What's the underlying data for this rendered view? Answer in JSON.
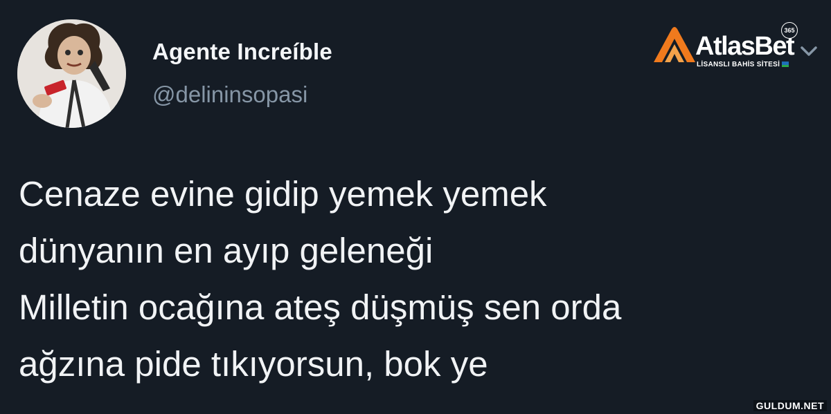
{
  "tweet": {
    "display_name": "Agente Increíble",
    "handle": "@delininsopasi",
    "text_lines": [
      "Cenaze evine gidip yemek yemek",
      "dünyanın en ayıp geleneği",
      "Milletin ocağına ateş düşmüş sen orda",
      "ağzına pide tıkıyorsun, bok ye"
    ],
    "avatar_icon": "profile-photo",
    "menu_icon": "chevron-down-icon"
  },
  "brand": {
    "name": "AtlasBet",
    "badge": "365",
    "tagline": "LİSANSLI BAHİS SİTESİ"
  },
  "watermark": "GULDUM.NET",
  "colors": {
    "background": "#151c25",
    "text_primary": "#f1f3f5",
    "text_secondary": "#8696a6",
    "brand_accent": "#f07a1d"
  }
}
